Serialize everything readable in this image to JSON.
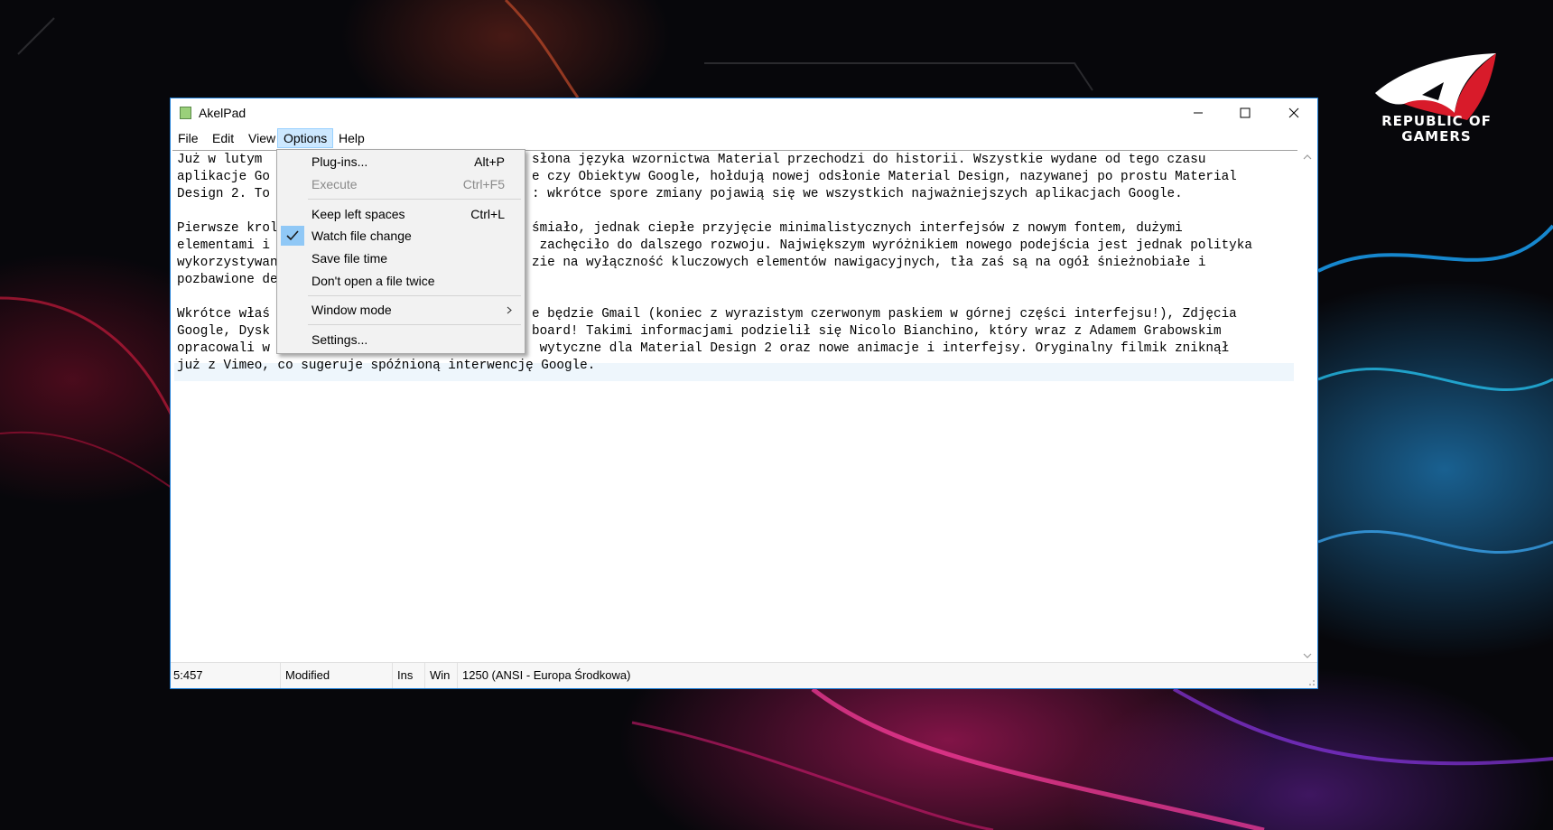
{
  "window": {
    "title": "AkelPad"
  },
  "menubar": {
    "items": [
      {
        "label": "File"
      },
      {
        "label": "Edit"
      },
      {
        "label": "View"
      },
      {
        "label": "Options"
      },
      {
        "label": "Help"
      }
    ],
    "active": "Options"
  },
  "options_menu": {
    "items": [
      {
        "label": "Plug-ins...",
        "shortcut": "Alt+P",
        "enabled": true
      },
      {
        "label": "Execute",
        "shortcut": "Ctrl+F5",
        "enabled": false
      },
      {
        "label": "Keep left spaces",
        "shortcut": "Ctrl+L",
        "enabled": true
      },
      {
        "label": "Watch file change",
        "shortcut": "",
        "enabled": true,
        "checked": true
      },
      {
        "label": "Save file time",
        "shortcut": "",
        "enabled": true
      },
      {
        "label": "Don't open a file twice",
        "shortcut": "",
        "enabled": true
      },
      {
        "label": "Window mode",
        "shortcut": "",
        "enabled": true,
        "submenu": true
      },
      {
        "label": "Settings...",
        "shortcut": "",
        "enabled": true
      }
    ]
  },
  "editor": {
    "lines": [
      "Już w lutym ",
      "aplikacje Go",
      "Design 2. To",
      "",
      "Pierwsze krol",
      "elementami i",
      "wykorzystywan",
      "pozbawione de",
      "",
      "",
      "Wkrótce właś",
      "Google, Dysk",
      "opracowali w",
      "już z Vimeo, co sugeruje spóźnioną interwencję Google."
    ],
    "lines_right": [
      "słona języka wzornictwa Material przechodzi do historii. Wszystkie wydane od tego czasu",
      "e czy Obiektyw Google, hołdują nowej odsłonie Material Design, nazywanej po prostu Material",
      ": wkrótce spore zmiany pojawią się we wszystkich najważniejszych aplikacjach Google.",
      "",
      "śmiało, jednak ciepłe przyjęcie minimalistycznych interfejsów z nowym fontem, dużymi",
      " zachęciło do dalszego rozwoju. Największym wyróżnikiem nowego podejścia jest jednak polityka",
      "zie na wyłączność kluczowych elementów nawigacyjnych, tła zaś są na ogół śnieżnobiałe i",
      "",
      "",
      "",
      "e będzie Gmail (koniec z wyrazistym czerwonym paskiem w górnej części interfejsu!), Zdjęcia",
      "board! Takimi informacjami podzielił się Nicolo Bianchino, który wraz z Adamem Grabowskim",
      " wytyczne dla Material Design 2 oraz nowe animacje i interfejsy. Oryginalny filmik zniknął",
      ""
    ]
  },
  "statusbar": {
    "position": "5:457",
    "state": "Modified",
    "insert_mode": "Ins",
    "newline": "Win",
    "encoding": "1250  (ANSI - Europa Środkowa)"
  },
  "brand": {
    "line1": "REPUBLIC OF",
    "line2": "GAMERS"
  },
  "colors": {
    "accent_border": "#1f7fd8",
    "menu_highlight": "#cce8ff",
    "check_highlight": "#90c8f6"
  }
}
